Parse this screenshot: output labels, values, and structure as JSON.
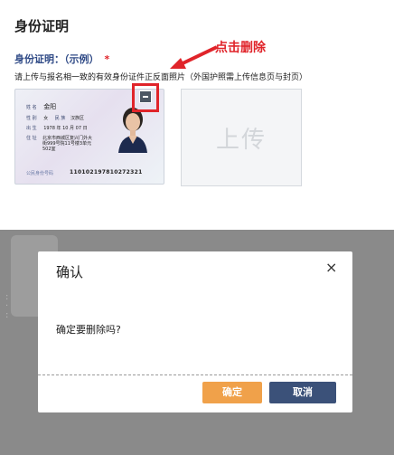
{
  "section": {
    "title": "身份证明"
  },
  "id_field": {
    "label": "身份证明：（示例）",
    "required_mark": "*",
    "instruction": "请上传与报名相一致的有效身份证件正反面照片（外国护照需上传信息页与封页）"
  },
  "annotation": {
    "text": "点击删除",
    "color": "#e0242a"
  },
  "id_card": {
    "name_label": "姓 名",
    "name": "金阳",
    "gender_label": "性 别",
    "gender": "女",
    "ethnicity_label": "民 族",
    "ethnicity": "汉族区",
    "birth_label": "出 生",
    "birth": "1978 年 10 月 07 日",
    "address_label": "住 址",
    "address_lines": [
      "北京市西城区复兴门外大",
      "街999号院11号楼3单元",
      "502室"
    ],
    "number_label": "公民身份号码",
    "number": "110102197810272321",
    "delete_icon": "minus-icon"
  },
  "upload": {
    "label": "上传"
  },
  "dialog": {
    "title": "确认",
    "close_icon": "close-icon",
    "close_glyph": "×",
    "message": "确定要删除吗?",
    "confirm_label": "确定",
    "cancel_label": "取消",
    "confirm_color": "#f0a14a",
    "cancel_color": "#3b5179"
  }
}
